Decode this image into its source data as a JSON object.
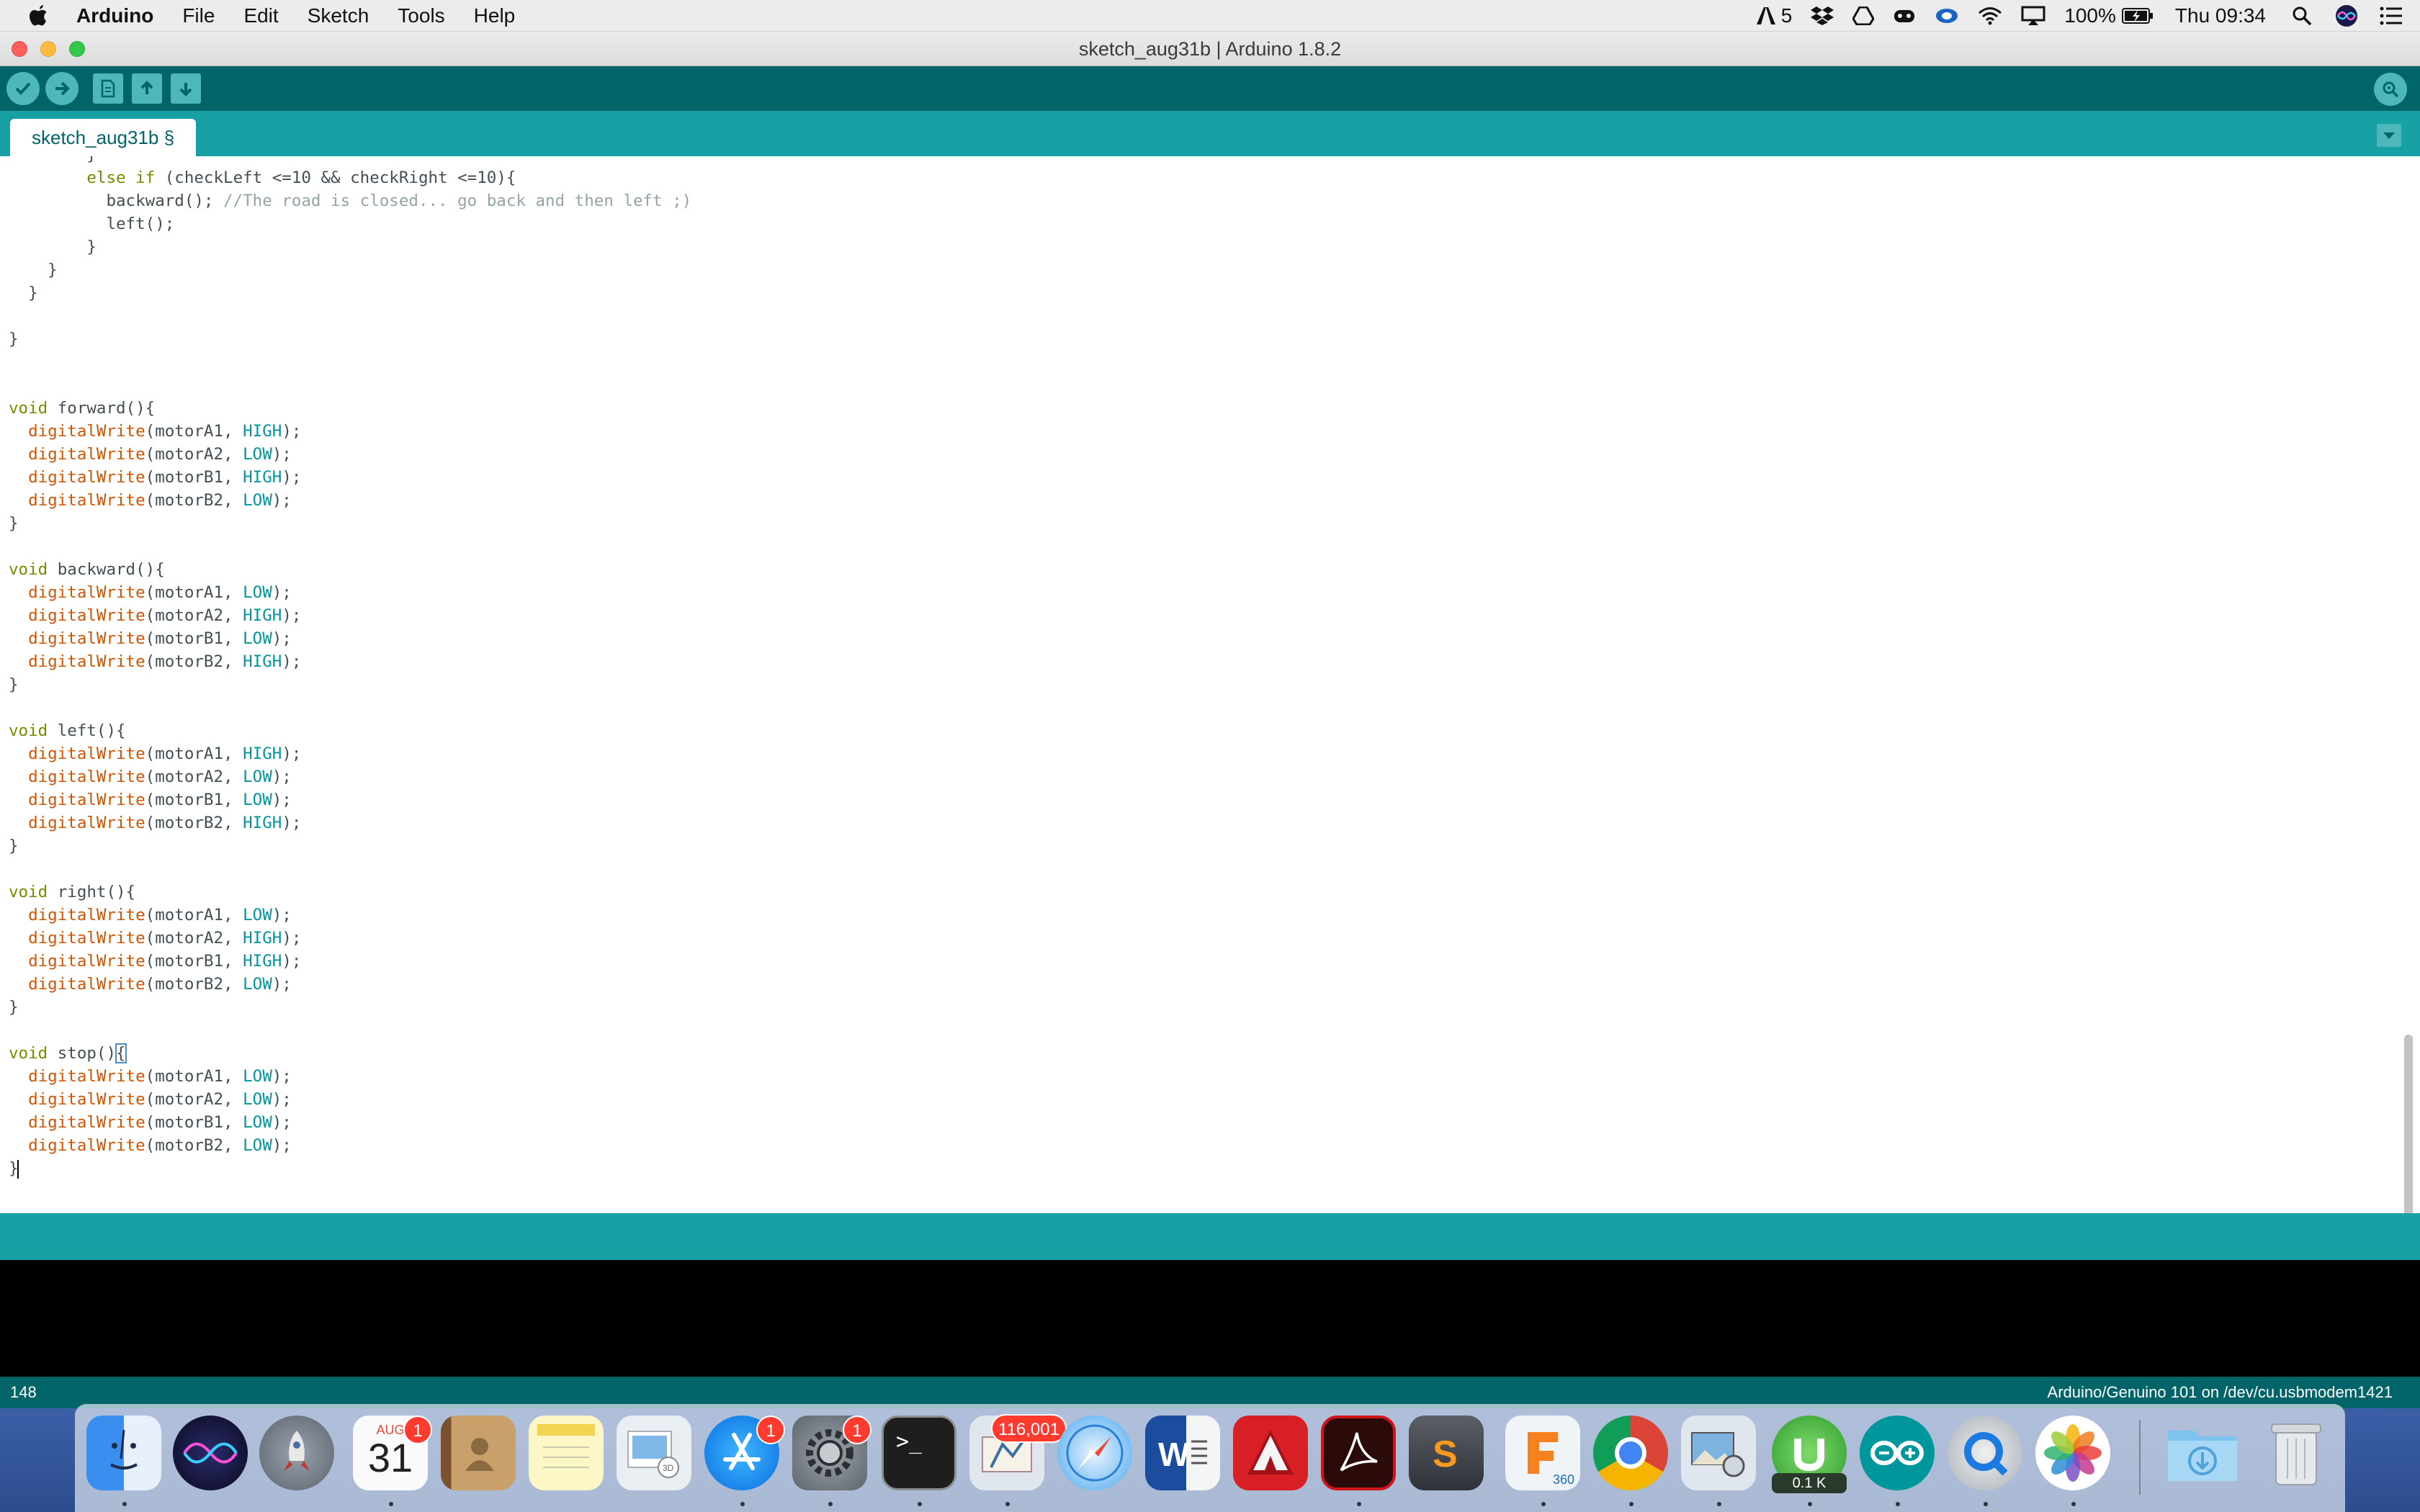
{
  "menubar": {
    "app_name": "Arduino",
    "items": [
      "File",
      "Edit",
      "Sketch",
      "Tools",
      "Help"
    ],
    "adobe_count": "5",
    "battery": "100%",
    "clock": "Thu 09:34"
  },
  "window": {
    "title": "sketch_aug31b | Arduino 1.8.2"
  },
  "tabs": {
    "active": "sketch_aug31b §"
  },
  "editor": {
    "lines": [
      "        }",
      "        else if (checkLeft <=10 && checkRight <=10){",
      "          backward(); //The road is closed... go back and then left ;)",
      "          left();",
      "        }",
      "    }",
      "  }",
      "",
      "}",
      "",
      "",
      "void forward(){",
      "  digitalWrite(motorA1, HIGH);",
      "  digitalWrite(motorA2, LOW);",
      "  digitalWrite(motorB1, HIGH);",
      "  digitalWrite(motorB2, LOW);",
      "}",
      "",
      "void backward(){",
      "  digitalWrite(motorA1, LOW);",
      "  digitalWrite(motorA2, HIGH);",
      "  digitalWrite(motorB1, LOW);",
      "  digitalWrite(motorB2, HIGH);",
      "}",
      "",
      "void left(){",
      "  digitalWrite(motorA1, HIGH);",
      "  digitalWrite(motorA2, LOW);",
      "  digitalWrite(motorB1, LOW);",
      "  digitalWrite(motorB2, HIGH);",
      "}",
      "",
      "void right(){",
      "  digitalWrite(motorA1, LOW);",
      "  digitalWrite(motorA2, HIGH);",
      "  digitalWrite(motorB1, HIGH);",
      "  digitalWrite(motorB2, LOW);",
      "}",
      "",
      "void stop(){",
      "  digitalWrite(motorA1, LOW);",
      "  digitalWrite(motorA2, LOW);",
      "  digitalWrite(motorB1, LOW);",
      "  digitalWrite(motorB2, LOW);",
      "}"
    ]
  },
  "footer": {
    "line_number": "148",
    "board_port": "Arduino/Genuino 101 on /dev/cu.usbmodem1421"
  },
  "dock": {
    "calendar_month": "AUG",
    "calendar_day": "31",
    "calendar_badge": "1",
    "appstore_badge": "1",
    "prefs_badge": "1",
    "mail_badge": "116,001",
    "fusion_label": "360",
    "utorrent_label": "0.1 K",
    "apps": [
      "finder-icon",
      "siri-icon",
      "launchpad-icon",
      "calendar-icon",
      "contacts-icon",
      "notes-icon",
      "preview-icon",
      "app-store-icon",
      "system-preferences-icon",
      "terminal-icon",
      "mail-icon",
      "safari-icon",
      "word-icon",
      "autocad-icon",
      "acrobat-icon",
      "sublime-text-icon",
      "fusion-360-icon",
      "chrome-icon",
      "image-capture-icon",
      "utorrent-icon",
      "arduino-icon",
      "quicktime-icon",
      "photos-icon",
      "downloads-folder-icon",
      "trash-icon"
    ]
  },
  "colors": {
    "toolbar": "#006468",
    "tabbar": "#17a1a5",
    "button": "#4db7bb",
    "keyword": "#728e00",
    "function": "#d35400",
    "constant": "#00979c",
    "comment": "#95a5a6"
  }
}
